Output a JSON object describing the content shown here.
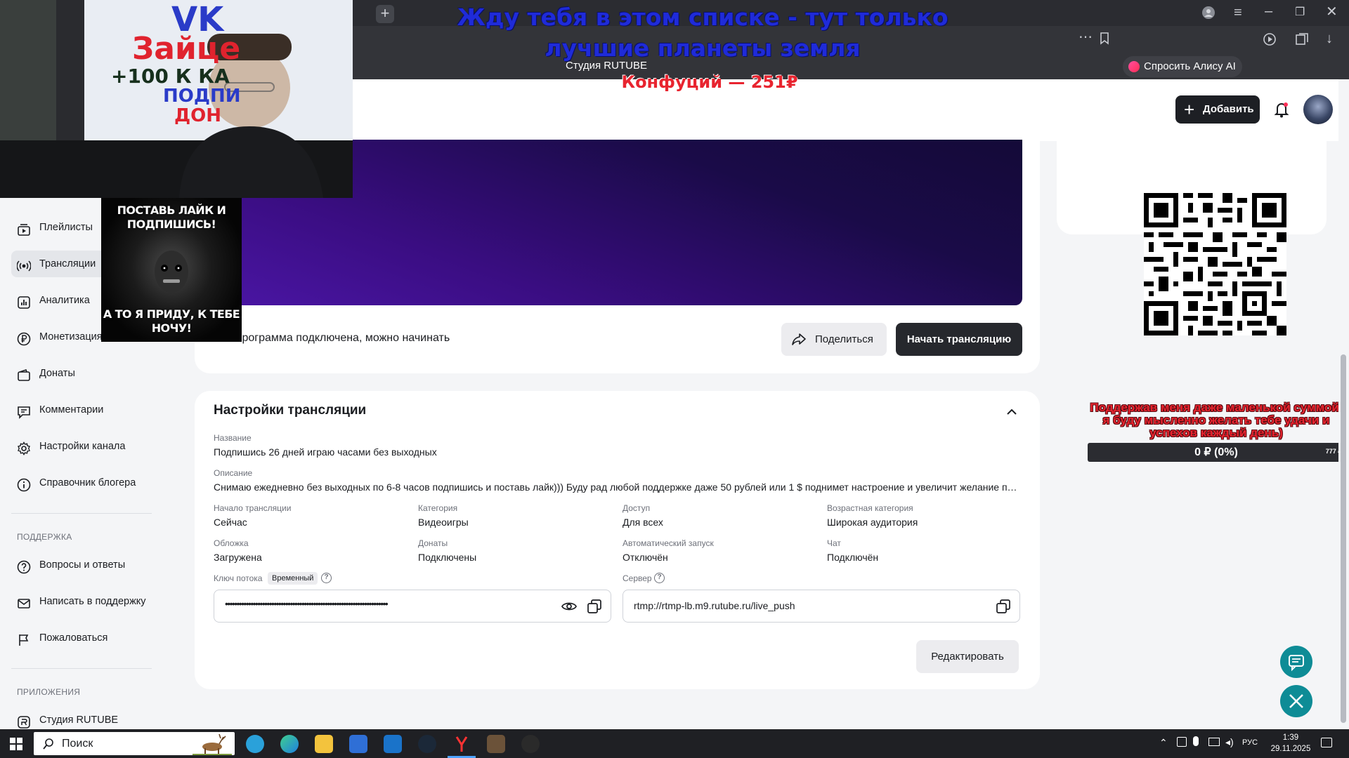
{
  "browser": {
    "tab_title": "Студия RUTUBE",
    "alice_label": "Спросить Алису AI"
  },
  "header": {
    "add_label": "Добавить"
  },
  "sidebar": {
    "items": [
      {
        "label": "Плейлисты"
      },
      {
        "label": "Трансляции"
      },
      {
        "label": "Аналитика"
      },
      {
        "label": "Монетизация"
      },
      {
        "label": "Донаты"
      },
      {
        "label": "Комментарии"
      },
      {
        "label": "Настройки канала"
      },
      {
        "label": "Справочник блогера"
      }
    ],
    "support_title": "ПОДДЕРЖКА",
    "support_items": [
      {
        "label": "Вопросы и ответы"
      },
      {
        "label": "Написать в поддержку"
      },
      {
        "label": "Пожаловаться"
      }
    ],
    "apps_title": "ПРИЛОЖЕНИЯ",
    "apps_items": [
      {
        "label": "Студия RUTUBE"
      }
    ]
  },
  "stream": {
    "status": "Программа подключена, можно начинать",
    "share_label": "Поделиться",
    "start_label": "Начать трансляцию"
  },
  "settings": {
    "title": "Настройки трансляции",
    "name_label": "Название",
    "name_value": "Подпишись 26 дней играю часами без выходных",
    "desc_label": "Описание",
    "desc_value": "Снимаю ежедневно без выходных по 6-8 часов подпишись и поставь лайк))) Буду рад любой поддержке даже 50 рублей или 1 $ поднимет настроение и увеличит желание про...",
    "fields": [
      {
        "label": "Начало трансляции",
        "value": "Сейчас"
      },
      {
        "label": "Категория",
        "value": "Видеоигры"
      },
      {
        "label": "Доступ",
        "value": "Для всех"
      },
      {
        "label": "Возрастная категория",
        "value": "Широкая аудитория"
      },
      {
        "label": "Обложка",
        "value": "Загружена"
      },
      {
        "label": "Донаты",
        "value": "Подключены"
      },
      {
        "label": "Автоматический запуск",
        "value": "Отключён"
      },
      {
        "label": "Чат",
        "value": "Подключён"
      }
    ],
    "key_label": "Ключ потока",
    "key_badge": "Временный",
    "key_mask": "••••••••••••••••••••••••••••••••••••••••••••••••••••••••••••••••••••••",
    "server_label": "Сервер",
    "server_value": "rtmp://rtmp-lb.m9.rutube.ru/live_push",
    "edit_label": "Редактировать"
  },
  "overlays": {
    "title": "Жду тебя в этом списке - тут только лучшие планеты земля",
    "donor": "Конфуций — 251₽",
    "banner_lines": [
      "VK",
      "Зайце",
      "+100 К КА",
      "ПОДПИ",
      "ДОН"
    ],
    "meme_top": "ПОСТАВЬ ЛАЙК И ПОДПИШИСЬ!",
    "meme_bottom": "А ТО Я ПРИДУ, К ТЕБЕ НОЧУ!",
    "donate_text": "Поддержав меня даже маленькой суммой, я буду мысленно желать тебе удачи и успехов каждый день)",
    "donate_amount": "0 ₽ (0%)",
    "donate_goal": "777 ₽",
    "donate_progress": 0
  },
  "taskbar": {
    "search_placeholder": "Поиск",
    "lang": "РУС",
    "time": "1:39",
    "date": "29.11.2025"
  },
  "colors": {
    "accent": "#26282d",
    "preview_gradient": "#4b16a6",
    "donate_text": "#e8242f",
    "overlay_title": "#1f2bd9",
    "fab": "#0e8c96"
  }
}
